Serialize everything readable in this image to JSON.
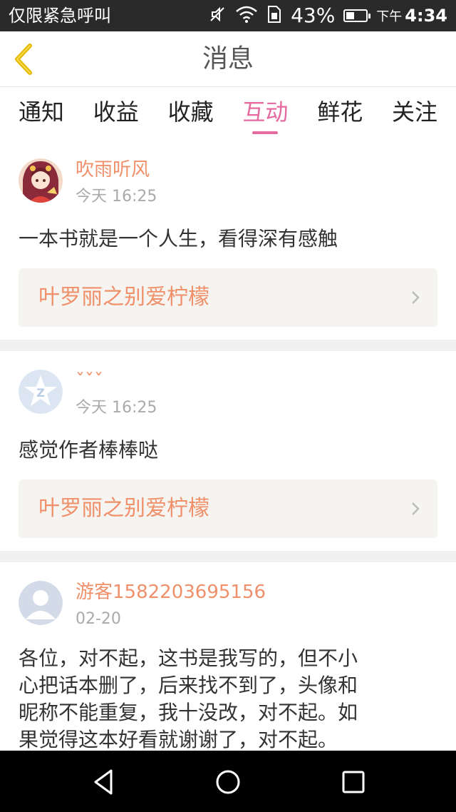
{
  "status_bar": {
    "carrier_text": "仅限紧急呼叫",
    "battery_percent": "43%",
    "battery_level": 0.43,
    "ampm": "下午",
    "time": "4:34",
    "icons": [
      "mute-icon",
      "wifi-icon",
      "sim-icon",
      "battery-icon"
    ]
  },
  "header": {
    "title": "消息",
    "back_icon": "chevron-left-icon"
  },
  "tabs": [
    {
      "label": "通知",
      "active": false
    },
    {
      "label": "收益",
      "active": false
    },
    {
      "label": "收藏",
      "active": false
    },
    {
      "label": "互动",
      "active": true
    },
    {
      "label": "鲜花",
      "active": false
    },
    {
      "label": "关注",
      "active": false
    }
  ],
  "messages": [
    {
      "username": "吹雨听风",
      "time": "今天 16:25",
      "content": "一本书就是一个人生，看得深有感触",
      "book_title": "叶罗丽之别爱柠檬"
    },
    {
      "username": "ˇˇˇ",
      "time": "今天 16:25",
      "content": "感觉作者棒棒哒",
      "book_title": "叶罗丽之别爱柠檬"
    },
    {
      "username": "游客1582203695156",
      "time": "02-20",
      "content_lines": [
        "各位，对不起，这书是我写的，但不小",
        "心把话本删了，后来找不到了，头像和",
        "昵称不能重复，我十没改，对不起。如",
        "果觉得这本好看就谢谢了，对不起。"
      ]
    }
  ],
  "colors": {
    "accent_pink": "#e56aa0",
    "name_orange": "#f0906a",
    "ref_bg": "#f5f4f0"
  },
  "nav": [
    "back-triangle-icon",
    "home-circle-icon",
    "recents-square-icon"
  ]
}
